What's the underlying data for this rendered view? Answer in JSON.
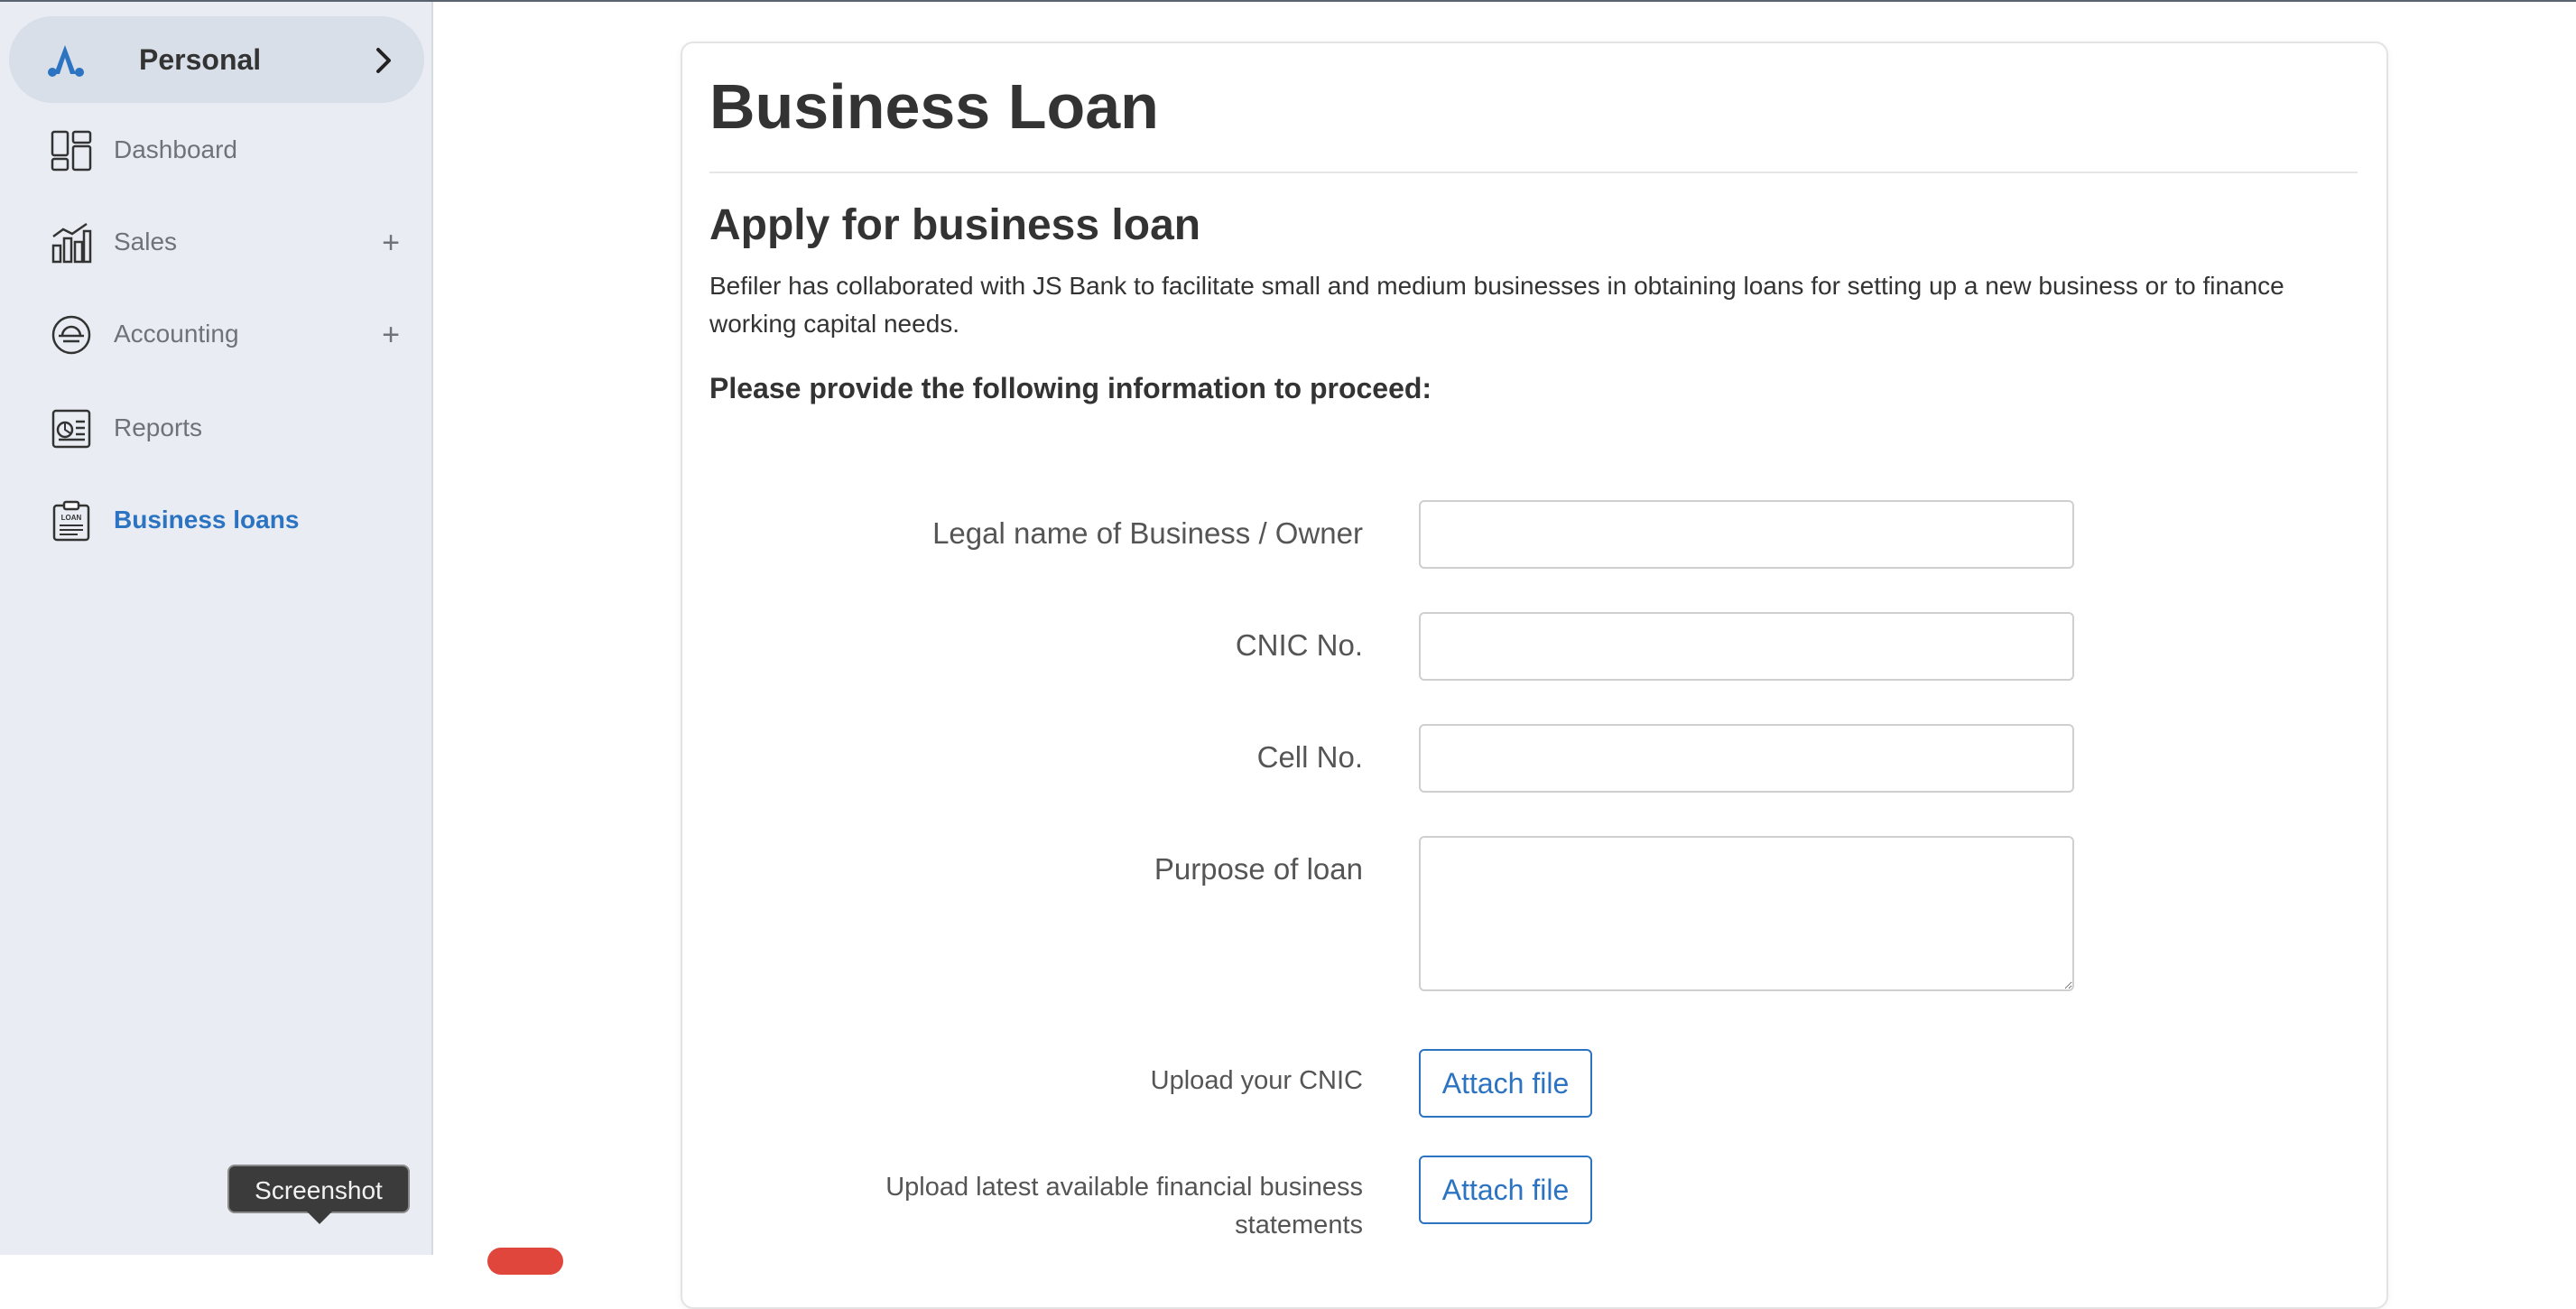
{
  "sidebar": {
    "account": {
      "name": "Personal"
    },
    "items": [
      {
        "label": "Dashboard"
      },
      {
        "label": "Sales"
      },
      {
        "label": "Accounting"
      },
      {
        "label": "Reports"
      },
      {
        "label": "Business loans"
      }
    ]
  },
  "tooltip": {
    "text": "Screenshot"
  },
  "main": {
    "title": "Business Loan",
    "section_title": "Apply for business loan",
    "intro": "Befiler has collaborated with JS Bank to facilitate small and medium businesses in obtaining loans for setting up a new business or to finance working capital needs.",
    "instruction": "Please provide the following information to proceed:",
    "fields": {
      "legal_name": {
        "label": "Legal name of Business / Owner",
        "value": ""
      },
      "cnic": {
        "label": "CNIC No.",
        "value": ""
      },
      "cell": {
        "label": "Cell No.",
        "value": ""
      },
      "purpose": {
        "label": "Purpose of loan",
        "value": ""
      }
    },
    "uploads": {
      "cnic": {
        "label": "Upload your CNIC",
        "button": "Attach file"
      },
      "statements": {
        "label_line1": "Upload latest available financial business",
        "label_line2": "statements",
        "button": "Attach file"
      }
    }
  },
  "colors": {
    "accent": "#2c73c2",
    "sidebar_bg": "#e9edf3",
    "account_bg": "#d9dfe8"
  }
}
